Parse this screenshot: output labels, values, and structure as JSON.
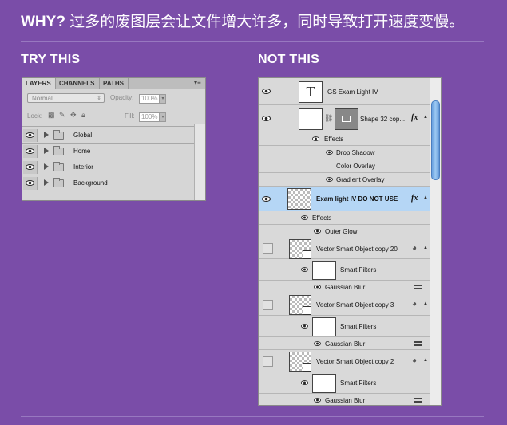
{
  "header": {
    "why": "WHY?",
    "text": " 过多的废图层会让文件增大许多，同时导致打开速度变慢。"
  },
  "sections": {
    "try_this": "TRY THIS",
    "not_this": "NOT THIS"
  },
  "left_panel": {
    "tabs": [
      "LAYERS",
      "CHANNELS",
      "PATHS"
    ],
    "blend_mode": "Normal",
    "opacity_label": "Opacity:",
    "opacity_value": "100%",
    "lock_label": "Lock:",
    "fill_label": "Fill:",
    "fill_value": "100%",
    "layers": [
      {
        "name": "Global"
      },
      {
        "name": "Home"
      },
      {
        "name": "Interior"
      },
      {
        "name": "Background"
      }
    ]
  },
  "right_panel": {
    "text_layer": "GS Exam Light IV",
    "shape_layer": "Shape 32 cop...",
    "effects_label": "Effects",
    "drop_shadow": "Drop Shadow",
    "color_overlay": "Color Overlay",
    "gradient_overlay": "Gradient Overlay",
    "selected_layer": "Exam light IV DO NOT USE",
    "outer_glow": "Outer Glow",
    "smart_objects": [
      {
        "name": "Vector Smart Object copy 20",
        "filters": "Smart Filters",
        "filter": "Gaussian Blur"
      },
      {
        "name": "Vector Smart Object copy 3",
        "filters": "Smart Filters",
        "filter": "Gaussian Blur"
      },
      {
        "name": "Vector Smart Object copy 2",
        "filters": "Smart Filters",
        "filter": "Gaussian Blur"
      }
    ],
    "fx": "fx"
  },
  "colors": {
    "background": "#7a4da8",
    "selection": "#b5d6f5"
  }
}
